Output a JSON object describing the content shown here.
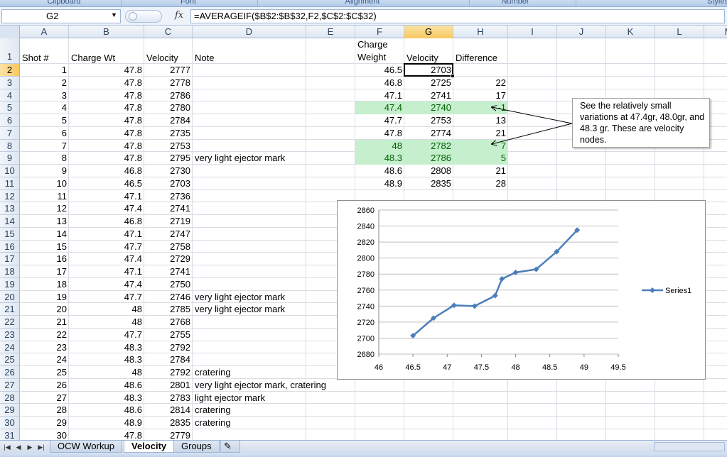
{
  "ribbon": {
    "groups": [
      "Clipboard",
      "Font",
      "Alignment",
      "Number",
      "Styles"
    ]
  },
  "formula_bar": {
    "name_box": "G2",
    "fx": "fx",
    "formula": "=AVERAGEIF($B$2:$B$32,F2,$C$2:$C$32)"
  },
  "columns": [
    "A",
    "B",
    "C",
    "D",
    "E",
    "F",
    "G",
    "H",
    "I",
    "J",
    "K",
    "L",
    "M"
  ],
  "rows": [
    "1",
    "2",
    "3",
    "4",
    "5",
    "6",
    "7",
    "8",
    "9",
    "10",
    "11",
    "12",
    "13",
    "14",
    "15",
    "16",
    "17",
    "18",
    "19",
    "20",
    "21",
    "22",
    "23",
    "24",
    "25",
    "26",
    "27",
    "28",
    "29",
    "30",
    "31"
  ],
  "headers": {
    "a": "Shot #",
    "b": "Charge Wt",
    "c": "Velocity",
    "d": "Note",
    "f_line1": "Charge",
    "f_line2": "Weight",
    "g": "Velocity",
    "h": "Difference"
  },
  "shots": [
    {
      "shot": "1",
      "wt": "47.8",
      "vel": "2777",
      "note": ""
    },
    {
      "shot": "2",
      "wt": "47.8",
      "vel": "2778",
      "note": ""
    },
    {
      "shot": "3",
      "wt": "47.8",
      "vel": "2786",
      "note": ""
    },
    {
      "shot": "4",
      "wt": "47.8",
      "vel": "2780",
      "note": ""
    },
    {
      "shot": "5",
      "wt": "47.8",
      "vel": "2784",
      "note": ""
    },
    {
      "shot": "6",
      "wt": "47.8",
      "vel": "2735",
      "note": ""
    },
    {
      "shot": "7",
      "wt": "47.8",
      "vel": "2753",
      "note": ""
    },
    {
      "shot": "8",
      "wt": "47.8",
      "vel": "2795",
      "note": "very light ejector mark"
    },
    {
      "shot": "9",
      "wt": "46.8",
      "vel": "2730",
      "note": ""
    },
    {
      "shot": "10",
      "wt": "46.5",
      "vel": "2703",
      "note": ""
    },
    {
      "shot": "11",
      "wt": "47.1",
      "vel": "2736",
      "note": ""
    },
    {
      "shot": "12",
      "wt": "47.4",
      "vel": "2741",
      "note": ""
    },
    {
      "shot": "13",
      "wt": "46.8",
      "vel": "2719",
      "note": ""
    },
    {
      "shot": "14",
      "wt": "47.1",
      "vel": "2747",
      "note": ""
    },
    {
      "shot": "15",
      "wt": "47.7",
      "vel": "2758",
      "note": ""
    },
    {
      "shot": "16",
      "wt": "47.4",
      "vel": "2729",
      "note": ""
    },
    {
      "shot": "17",
      "wt": "47.1",
      "vel": "2741",
      "note": ""
    },
    {
      "shot": "18",
      "wt": "47.4",
      "vel": "2750",
      "note": ""
    },
    {
      "shot": "19",
      "wt": "47.7",
      "vel": "2746",
      "note": "very light ejector mark"
    },
    {
      "shot": "20",
      "wt": "48",
      "vel": "2785",
      "note": "very light ejector mark"
    },
    {
      "shot": "21",
      "wt": "48",
      "vel": "2768",
      "note": ""
    },
    {
      "shot": "22",
      "wt": "47.7",
      "vel": "2755",
      "note": ""
    },
    {
      "shot": "23",
      "wt": "48.3",
      "vel": "2792",
      "note": ""
    },
    {
      "shot": "24",
      "wt": "48.3",
      "vel": "2784",
      "note": ""
    },
    {
      "shot": "25",
      "wt": "48",
      "vel": "2792",
      "note": "cratering"
    },
    {
      "shot": "26",
      "wt": "48.6",
      "vel": "2801",
      "note": "very light ejector mark, cratering"
    },
    {
      "shot": "27",
      "wt": "48.3",
      "vel": "2783",
      "note": "light ejector mark"
    },
    {
      "shot": "28",
      "wt": "48.6",
      "vel": "2814",
      "note": "cratering"
    },
    {
      "shot": "29",
      "wt": "48.9",
      "vel": "2835",
      "note": "cratering"
    },
    {
      "shot": "30",
      "wt": "47.8",
      "vel": "2779",
      "note": ""
    }
  ],
  "summary": [
    {
      "wt": "46.5",
      "vel": "2703",
      "diff": "",
      "highlight": false
    },
    {
      "wt": "46.8",
      "vel": "2725",
      "diff": "22",
      "highlight": false
    },
    {
      "wt": "47.1",
      "vel": "2741",
      "diff": "17",
      "highlight": false
    },
    {
      "wt": "47.4",
      "vel": "2740",
      "diff": "-1",
      "highlight": true
    },
    {
      "wt": "47.7",
      "vel": "2753",
      "diff": "13",
      "highlight": false
    },
    {
      "wt": "47.8",
      "vel": "2774",
      "diff": "21",
      "highlight": false
    },
    {
      "wt": "48",
      "vel": "2782",
      "diff": "7",
      "highlight": true
    },
    {
      "wt": "48.3",
      "vel": "2786",
      "diff": "5",
      "highlight": true
    },
    {
      "wt": "48.6",
      "vel": "2808",
      "diff": "21",
      "highlight": false
    },
    {
      "wt": "48.9",
      "vel": "2835",
      "diff": "28",
      "highlight": false
    }
  ],
  "callout": {
    "text": "See the relatively  small variations at 47.4gr, 48.0gr, and 48.3 gr. These are velocity nodes."
  },
  "colors": {
    "highlight_fill": "#c6efce",
    "highlight_text": "#006100",
    "series_line": "#4a7ebb"
  },
  "chart_data": {
    "type": "line",
    "x": [
      46.5,
      46.8,
      47.1,
      47.4,
      47.7,
      47.8,
      48,
      48.3,
      48.6,
      48.9
    ],
    "series": [
      {
        "name": "Series1",
        "values": [
          2703,
          2725,
          2741,
          2740,
          2753,
          2774,
          2782,
          2786,
          2808,
          2835
        ]
      }
    ],
    "xlim": [
      46,
      49.5
    ],
    "ylim": [
      2680,
      2860
    ],
    "x_ticks": [
      "46",
      "46.5",
      "47",
      "47.5",
      "48",
      "48.5",
      "49",
      "49.5"
    ],
    "y_ticks": [
      "2680",
      "2700",
      "2720",
      "2740",
      "2760",
      "2780",
      "2800",
      "2820",
      "2840",
      "2860"
    ],
    "x_tick_values": [
      46,
      46.5,
      47,
      47.5,
      48,
      48.5,
      49,
      49.5
    ],
    "y_tick_values": [
      2680,
      2700,
      2720,
      2740,
      2760,
      2780,
      2800,
      2820,
      2840,
      2860
    ],
    "grid": "horizontal",
    "legend_position": "right",
    "title": "",
    "xlabel": "",
    "ylabel": ""
  },
  "sheet_tabs": [
    {
      "label": "OCW Workup",
      "active": false
    },
    {
      "label": "Velocity",
      "active": true
    },
    {
      "label": "Groups",
      "active": false
    }
  ]
}
